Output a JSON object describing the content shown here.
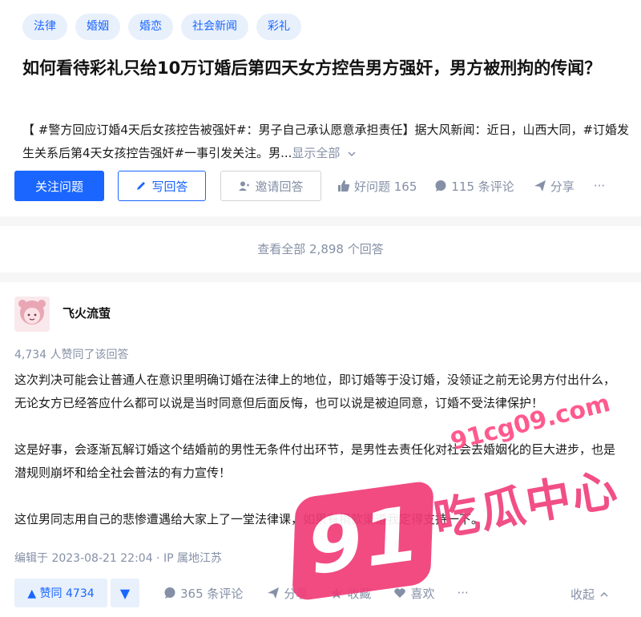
{
  "question": {
    "tags": [
      "法律",
      "婚姻",
      "婚恋",
      "社会新闻",
      "彩礼"
    ],
    "title": "如何看待彩礼只给10万订婚后第四天女方控告男方强奸，男方被刑拘的传闻？",
    "excerpt": "【 #警方回应订婚4天后女孩控告被强奸#：男子自己承认愿意承担责任】据大风新闻：近日，山西大同，#订婚发生关系后第4天女孩控告强奸#一事引发关注。男...",
    "show_all": "显示全部",
    "follow_button": "关注问题",
    "write_answer": "写回答",
    "invite_answer": "邀请回答",
    "good_question": "好问题 165",
    "comments": "115 条评论",
    "share": "分享",
    "more": "···"
  },
  "view_all": "查看全部 2,898 个回答",
  "answer": {
    "author": "飞火流萤",
    "vote_info": "4,734 人赞同了该回答",
    "paragraphs": [
      "这次判决可能会让普通人在意识里明确订婚在法律上的地位，即订婚等于没订婚，没领证之前无论男方付出什么，无论女方已经答应什么都可以说是当时同意但后面反悔，也可以说是被迫同意，订婚不受法律保护！",
      "这是好事，会逐渐瓦解订婚这个结婚前的男性无条件付出环节，是男性去责任化对社会去婚姻化的巨大进步，也是潜规则崩坏和给全社会普法的有力宣传！",
      "这位男同志用自己的悲惨遭遇给大家上了一堂法律课，如果有捐款渠道我定得支持一下。"
    ],
    "edit_info": "编辑于 2023-08-21 22:04 · IP 属地江苏",
    "vote_up": "▲ 赞同 4734",
    "vote_down": "▼",
    "comments": "365 条评论",
    "share": "分享",
    "collect": "收藏",
    "like": "喜欢",
    "more": "···",
    "collapse": "收起"
  },
  "watermark": {
    "url": "91cg09.com",
    "number": "91",
    "text": "吃瓜中心"
  },
  "colors": {
    "accent": "#1a66ff",
    "gray": "#8590a6",
    "tag_bg": "#e8f0fc",
    "watermark": "#f03c78"
  }
}
